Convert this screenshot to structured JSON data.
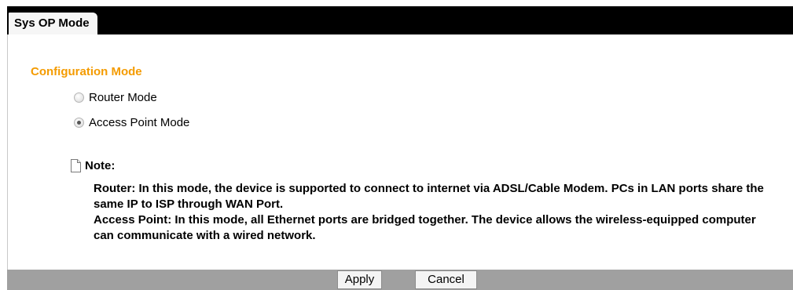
{
  "tabs": [
    {
      "label": "Sys OP Mode",
      "active": true
    }
  ],
  "section": {
    "title": "Configuration Mode"
  },
  "modes": [
    {
      "label": "Router Mode",
      "selected": false
    },
    {
      "label": "Access Point Mode",
      "selected": true
    }
  ],
  "note": {
    "title": "Note:",
    "icon": "document-icon",
    "lines": [
      "Router: In this mode, the device is supported to connect to internet via ADSL/Cable Modem. PCs in LAN ports share the same IP to ISP through WAN Port.",
      "Access Point: In this mode, all Ethernet ports are bridged together. The device allows the wireless-equipped computer can communicate with a wired network."
    ]
  },
  "footer": {
    "apply_label": "Apply",
    "cancel_label": "Cancel"
  },
  "colors": {
    "tabbar": "#000000",
    "section_title": "#f49b00",
    "footer": "#a0a0a0"
  }
}
